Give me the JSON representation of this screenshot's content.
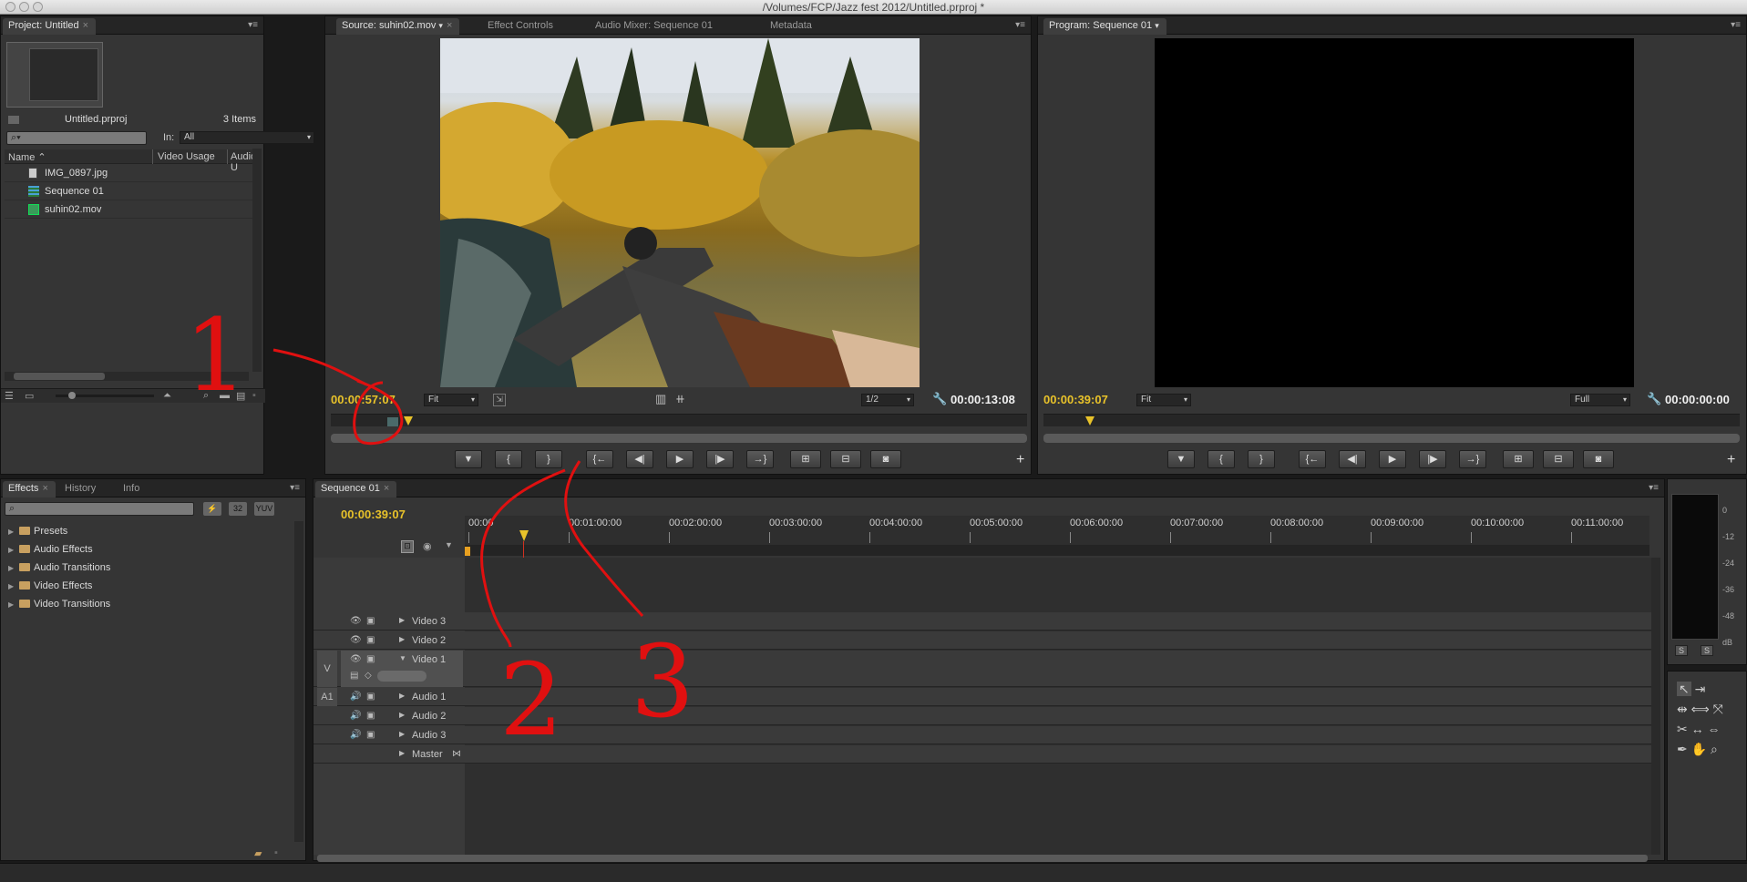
{
  "window": {
    "title": "/Volumes/FCP/Jazz fest 2012/Untitled.prproj *"
  },
  "project": {
    "tab": "Project: Untitled",
    "file": "Untitled.prproj",
    "count": "3 Items",
    "in_label": "In:",
    "in_value": "All",
    "columns": [
      "Name",
      "Video Usage",
      "Audio U"
    ],
    "items": [
      {
        "name": "IMG_0897.jpg",
        "icon": "image-file-icon"
      },
      {
        "name": "Sequence 01",
        "icon": "sequence-icon"
      },
      {
        "name": "suhin02.mov",
        "icon": "movie-file-icon"
      }
    ]
  },
  "source": {
    "tabs": [
      "Source: suhin02.mov",
      "Effect Controls",
      "Audio Mixer: Sequence 01",
      "Metadata"
    ],
    "timecode_current": "00:00:57:07",
    "fit": "Fit",
    "resolution": "1/2",
    "timecode_duration": "00:00:13:08"
  },
  "program": {
    "tab": "Program: Sequence 01",
    "timecode_current": "00:00:39:07",
    "fit": "Fit",
    "resolution": "Full",
    "timecode_duration": "00:00:00:00"
  },
  "effects": {
    "tabs": [
      "Effects",
      "History",
      "Info"
    ],
    "badges": [
      "32",
      "YUV"
    ],
    "folders": [
      "Presets",
      "Audio Effects",
      "Audio Transitions",
      "Video Effects",
      "Video Transitions"
    ]
  },
  "timeline": {
    "tab": "Sequence 01",
    "timecode": "00:00:39:07",
    "ruler": [
      "00:00",
      "00:01:00:00",
      "00:02:00:00",
      "00:03:00:00",
      "00:04:00:00",
      "00:05:00:00",
      "00:06:00:00",
      "00:07:00:00",
      "00:08:00:00",
      "00:09:00:00",
      "00:10:00:00",
      "00:11:00:00",
      "0"
    ],
    "video_tracks": [
      "Video 3",
      "Video 2",
      "Video 1"
    ],
    "audio_tracks": [
      "Audio 1",
      "Audio 2",
      "Audio 3"
    ],
    "master": "Master",
    "v_target": "V",
    "a_target": "A1"
  },
  "meter": {
    "scale": [
      "0",
      "-12",
      "-24",
      "-36",
      "-48",
      "dB"
    ],
    "solo": [
      "S",
      "S"
    ]
  },
  "annotations": [
    "1",
    "2",
    "3"
  ],
  "colors": {
    "timecode": "#e8c22a",
    "annotation": "#e01010",
    "playhead": "#d03020"
  }
}
